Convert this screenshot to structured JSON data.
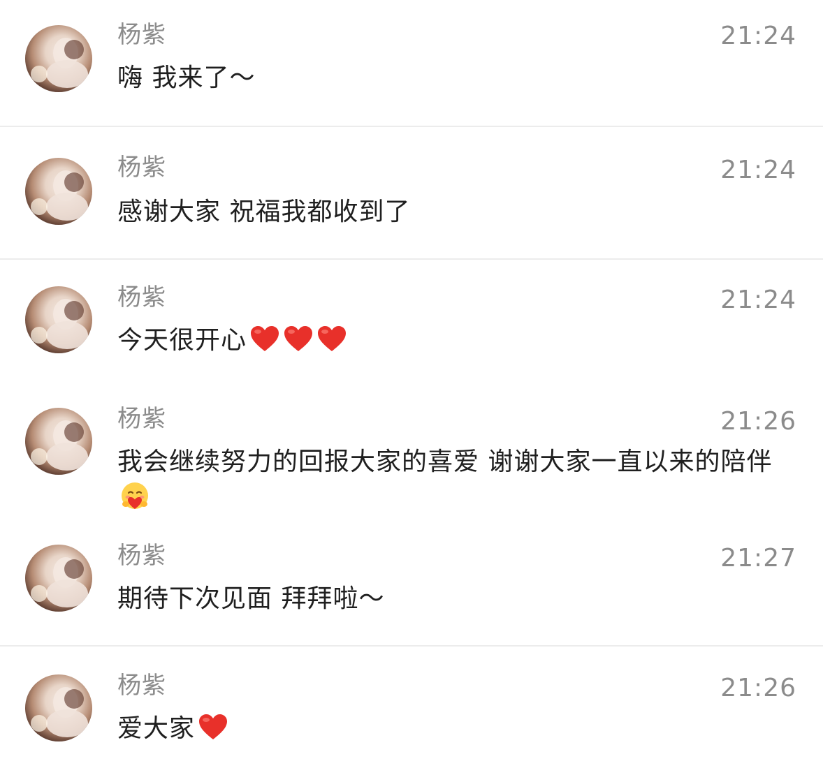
{
  "messages": [
    {
      "name": "杨紫",
      "time": "21:24",
      "text": "嗨 我来了～",
      "emojis": []
    },
    {
      "name": "杨紫",
      "time": "21:24",
      "text": "感谢大家 祝福我都收到了",
      "emojis": []
    },
    {
      "name": "杨紫",
      "time": "21:24",
      "text": "今天很开心",
      "emojis": [
        "red-heart-icon",
        "red-heart-icon",
        "red-heart-icon"
      ]
    },
    {
      "name": "杨紫",
      "time": "21:26",
      "text": "我会继续努力的回报大家的喜爱 谢谢大家一直以来的陪伴",
      "emojis": [
        "hugging-face-icon"
      ]
    },
    {
      "name": "杨紫",
      "time": "21:27",
      "text": "期待下次见面 拜拜啦～",
      "emojis": []
    },
    {
      "name": "杨紫",
      "time": "21:26",
      "text": "爱大家",
      "emojis": [
        "red-heart-icon"
      ]
    }
  ],
  "colors": {
    "name": "#8b8b8b",
    "time": "#8b8b8b",
    "text": "#1f1f1f",
    "divider": "#ececec",
    "heart": "#e8302a"
  }
}
